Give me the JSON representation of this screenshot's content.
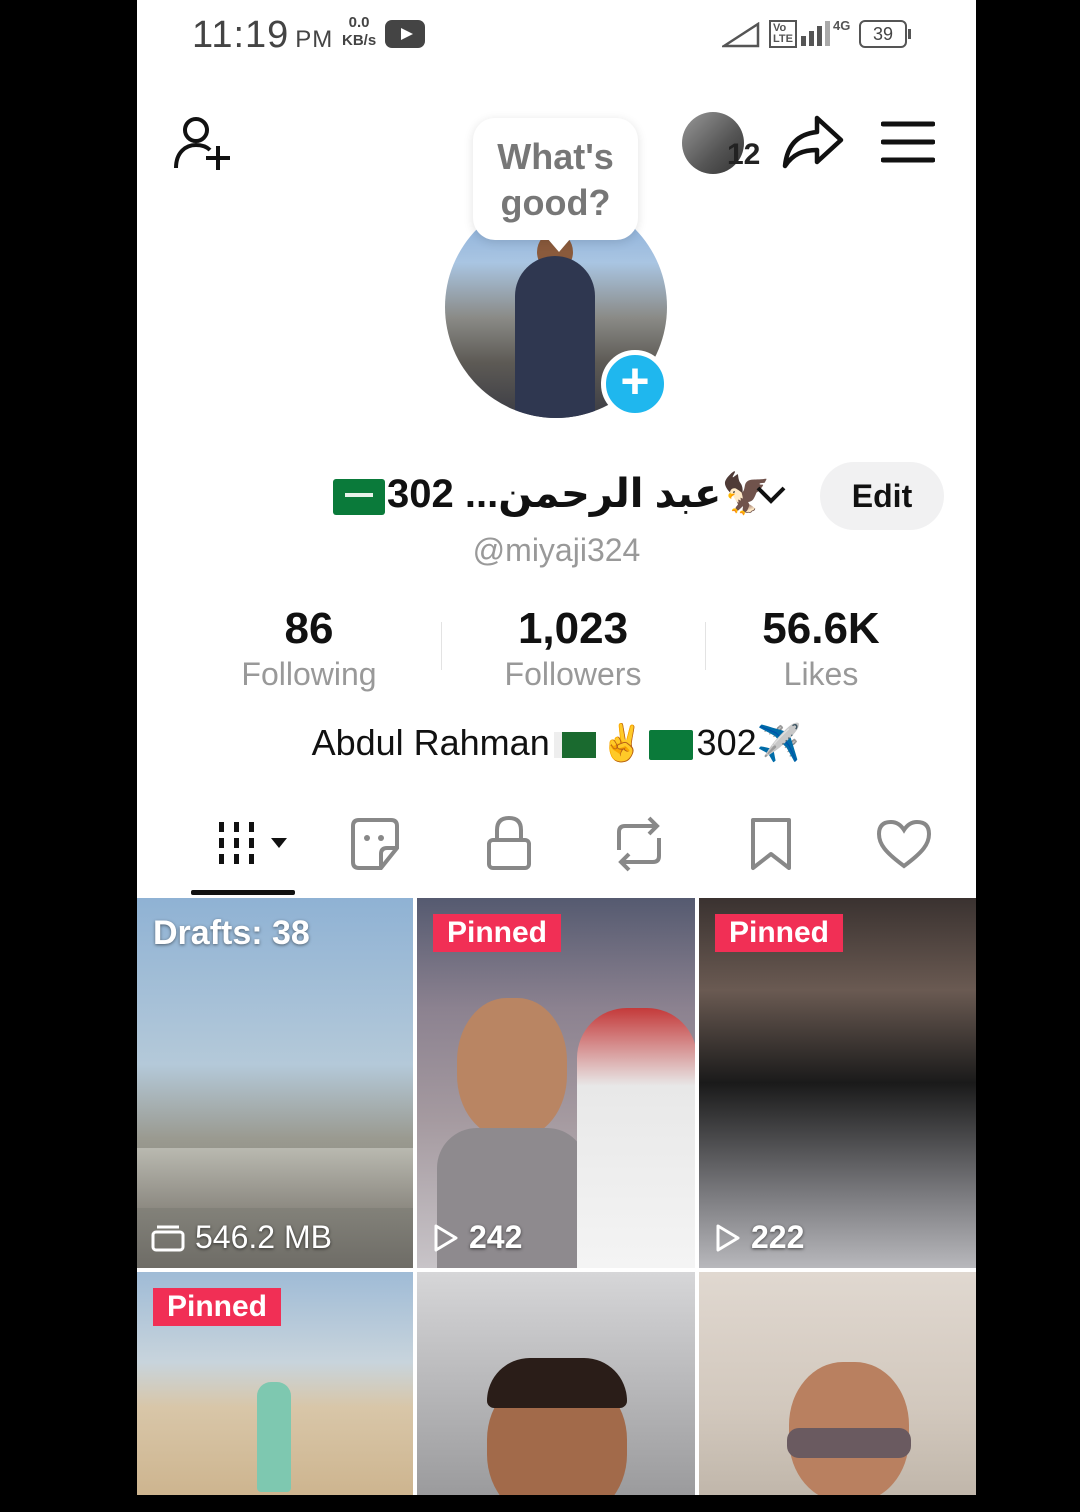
{
  "status_bar": {
    "time": "11:19",
    "ampm": "PM",
    "net_speed": "0.0",
    "net_unit": "KB/s",
    "volte": "Vo LTE",
    "net_type": "4G",
    "battery": "39"
  },
  "header": {
    "story_count": "12",
    "bubble_line1": "What's",
    "bubble_line2": "good?"
  },
  "profile": {
    "display_name": "عبد الرحمن... 302🦅",
    "edit_label": "Edit",
    "handle": "@miyaji324",
    "bio_text": "Abdul Rahman",
    "bio_emoji": "✌️",
    "bio_tail": "302✈️"
  },
  "stats": [
    {
      "value": "86",
      "label": "Following"
    },
    {
      "value": "1,023",
      "label": "Followers"
    },
    {
      "value": "56.6K",
      "label": "Likes"
    }
  ],
  "tabs": [
    "videos-grid",
    "stickers",
    "private",
    "reposts",
    "favorites",
    "liked"
  ],
  "grid": {
    "drafts_label": "Drafts: 38",
    "drafts_size": "546.2 MB",
    "pinned_label": "Pinned",
    "views_1": "242",
    "views_2": "222"
  },
  "colors": {
    "accent_blue": "#1fb7ee",
    "pinned_red": "#f12f55"
  }
}
